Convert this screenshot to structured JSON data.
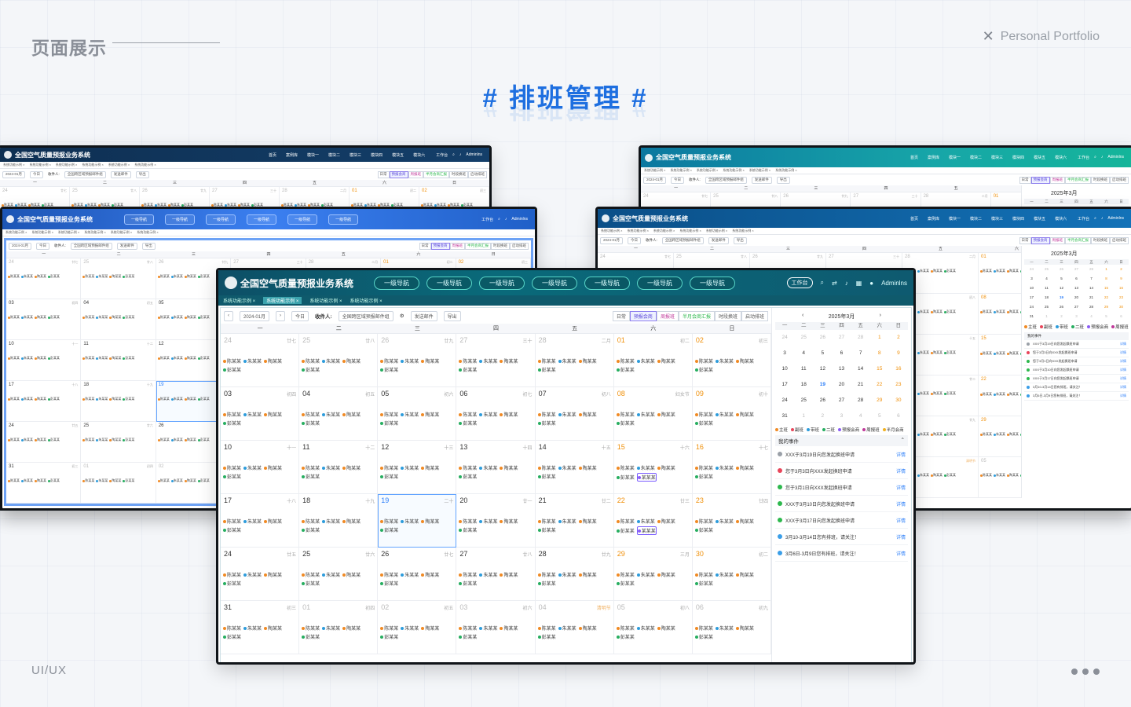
{
  "page": {
    "section_title": "页面展示",
    "portfolio": "Personal Portfolio",
    "main_title": "# 排班管理 #",
    "footer_left": "UI/UX"
  },
  "app": {
    "title": "全国空气质量预报业务系统",
    "nav_generic": [
      "首页",
      "案例库",
      "模块一",
      "模块二",
      "模块三",
      "模块四",
      "模块五",
      "模块六"
    ],
    "nav_first": "一级导航",
    "workbench": "工作台",
    "user": "Adminlns",
    "tabs": [
      "系统功能示例",
      "系统功能示例",
      "系统功能示例",
      "系统功能示例"
    ],
    "month_value": "2024-01月",
    "today_btn": "今日",
    "recipient_label": "收件人:",
    "recipient_value": "全国跨区域预报邮件组",
    "send_mail": "发送邮件",
    "export": "导出",
    "view_tabs": [
      "日常",
      "预报会商",
      "周报班",
      "半月会商汇报",
      "时段换班",
      "启动排班"
    ],
    "weekdays": [
      "一",
      "二",
      "三",
      "四",
      "五",
      "六",
      "日"
    ],
    "names": [
      "陈某某",
      "朱某某",
      "陶某某",
      "彭某某",
      "某某某"
    ],
    "mini_month": "2025年3月",
    "legend": [
      "主班",
      "副班",
      "带班",
      "二班",
      "预报会商",
      "周报班",
      "半月会商"
    ],
    "my_events": "我的事件",
    "detail": "详情",
    "events": [
      {
        "text": "XXX于3月19日向您发起换班申请",
        "color": "#9aa0a8"
      },
      {
        "text": "您于3月3日向XXX发起换班申请",
        "color": "#e8455a"
      },
      {
        "text": "您于3月1日向XXX发起换班申请",
        "color": "#2db84d"
      },
      {
        "text": "XXX于3月10日向您发起换班申请",
        "color": "#2db84d"
      },
      {
        "text": "XXX于3月17日向您发起换班申请",
        "color": "#2db84d"
      },
      {
        "text": "3月10-3月14日您有排班，请关注！",
        "color": "#3a9ee8"
      },
      {
        "text": "3月6日-3月9日您有排班，请关注！",
        "color": "#3a9ee8"
      }
    ]
  },
  "calendar": {
    "days": [
      {
        "d": "24",
        "l": "廿七",
        "dim": true
      },
      {
        "d": "25",
        "l": "廿八",
        "dim": true
      },
      {
        "d": "26",
        "l": "廿九",
        "dim": true
      },
      {
        "d": "27",
        "l": "三十",
        "dim": true
      },
      {
        "d": "28",
        "l": "二月",
        "dim": true
      },
      {
        "d": "01",
        "l": "初二",
        "we": true
      },
      {
        "d": "02",
        "l": "初三",
        "we": true
      },
      {
        "d": "03",
        "l": "初四"
      },
      {
        "d": "04",
        "l": "初五"
      },
      {
        "d": "05",
        "l": "初六"
      },
      {
        "d": "06",
        "l": "初七"
      },
      {
        "d": "07",
        "l": "初八"
      },
      {
        "d": "08",
        "l": "妇女节",
        "we": true
      },
      {
        "d": "09",
        "l": "初十",
        "we": true
      },
      {
        "d": "10",
        "l": "十一"
      },
      {
        "d": "11",
        "l": "十二"
      },
      {
        "d": "12",
        "l": "十三"
      },
      {
        "d": "13",
        "l": "十四"
      },
      {
        "d": "14",
        "l": "十五"
      },
      {
        "d": "15",
        "l": "十六",
        "we": true
      },
      {
        "d": "16",
        "l": "十七",
        "we": true
      },
      {
        "d": "17",
        "l": "十八"
      },
      {
        "d": "18",
        "l": "十九"
      },
      {
        "d": "19",
        "l": "二十",
        "today": true
      },
      {
        "d": "20",
        "l": "廿一"
      },
      {
        "d": "21",
        "l": "廿二"
      },
      {
        "d": "22",
        "l": "廿三",
        "we": true
      },
      {
        "d": "23",
        "l": "廿四",
        "we": true
      },
      {
        "d": "24",
        "l": "廿五"
      },
      {
        "d": "25",
        "l": "廿六"
      },
      {
        "d": "26",
        "l": "廿七"
      },
      {
        "d": "27",
        "l": "廿八"
      },
      {
        "d": "28",
        "l": "廿九"
      },
      {
        "d": "29",
        "l": "三月",
        "we": true
      },
      {
        "d": "30",
        "l": "初二",
        "we": true
      },
      {
        "d": "31",
        "l": "初三"
      },
      {
        "d": "01",
        "l": "初四",
        "dim": true
      },
      {
        "d": "02",
        "l": "初五",
        "dim": true
      },
      {
        "d": "03",
        "l": "初六",
        "dim": true
      },
      {
        "d": "04",
        "l": "清明节",
        "dim": true
      },
      {
        "d": "05",
        "l": "初八",
        "dim": true
      },
      {
        "d": "06",
        "l": "初九",
        "dim": true
      }
    ],
    "mini": [
      "24",
      "25",
      "26",
      "27",
      "28",
      "1",
      "2",
      "3",
      "4",
      "5",
      "6",
      "7",
      "8",
      "9",
      "10",
      "11",
      "12",
      "13",
      "14",
      "15",
      "16",
      "17",
      "18",
      "19",
      "20",
      "21",
      "22",
      "23",
      "24",
      "25",
      "26",
      "27",
      "28",
      "29",
      "30",
      "31",
      "1",
      "2",
      "3",
      "4",
      "5",
      "6"
    ]
  },
  "colors": {
    "tag1": "#f08a24",
    "tag2": "#2d9cdb",
    "tag3": "#27ae60",
    "tag4": "#8b5cf6",
    "accent": "#1e6fe0"
  }
}
